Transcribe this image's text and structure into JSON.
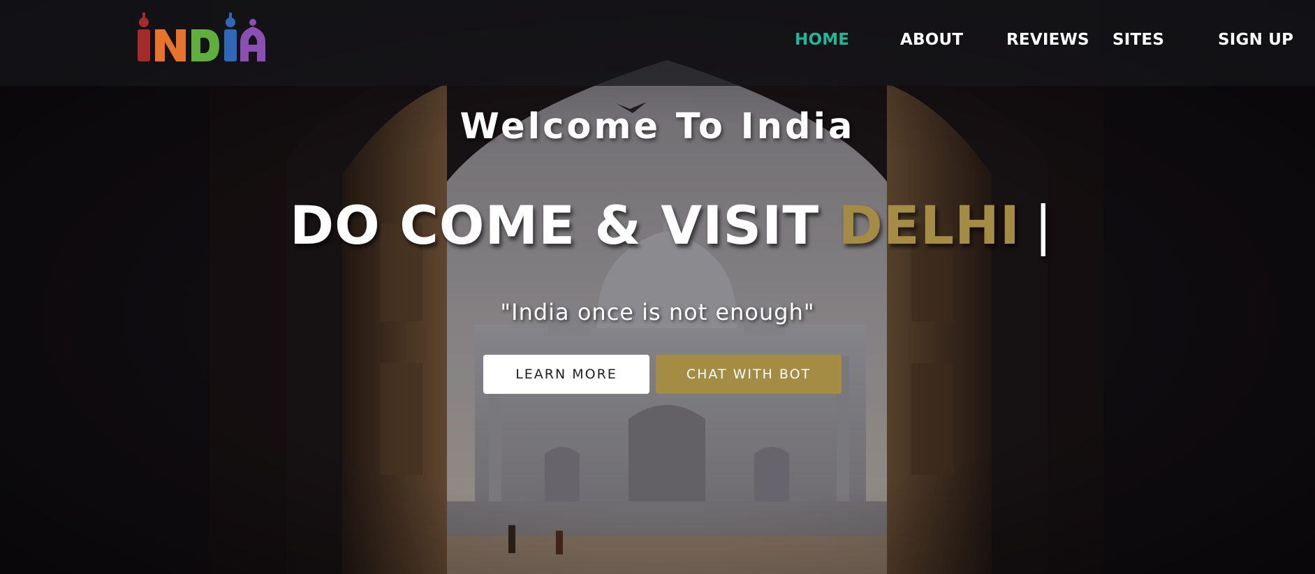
{
  "brand": {
    "logo_text": "INDIA",
    "logo_colors": [
      "#a52a2a",
      "#e8732a",
      "#5fae3e",
      "#2f68b8",
      "#8b4fb3"
    ]
  },
  "nav": {
    "items": [
      {
        "label": "HOME",
        "active": true
      },
      {
        "label": "ABOUT",
        "active": false
      },
      {
        "label": "REVIEWS",
        "active": false
      },
      {
        "label": "SITES",
        "active": false
      },
      {
        "label": "SIGN UP",
        "active": false
      }
    ]
  },
  "hero": {
    "welcome": "Welcome To India",
    "headline_prefix": "DO COME & VISIT",
    "headline_city": "DELHI",
    "cursor": "|",
    "quote": "\"India once is not enough\"",
    "buttons": {
      "learn_more": "LEARN MORE",
      "chat_bot": "CHAT WITH BOT"
    }
  },
  "colors": {
    "accent_gold": "#a58c45",
    "nav_active": "#1fb89a",
    "text": "#ffffff"
  }
}
